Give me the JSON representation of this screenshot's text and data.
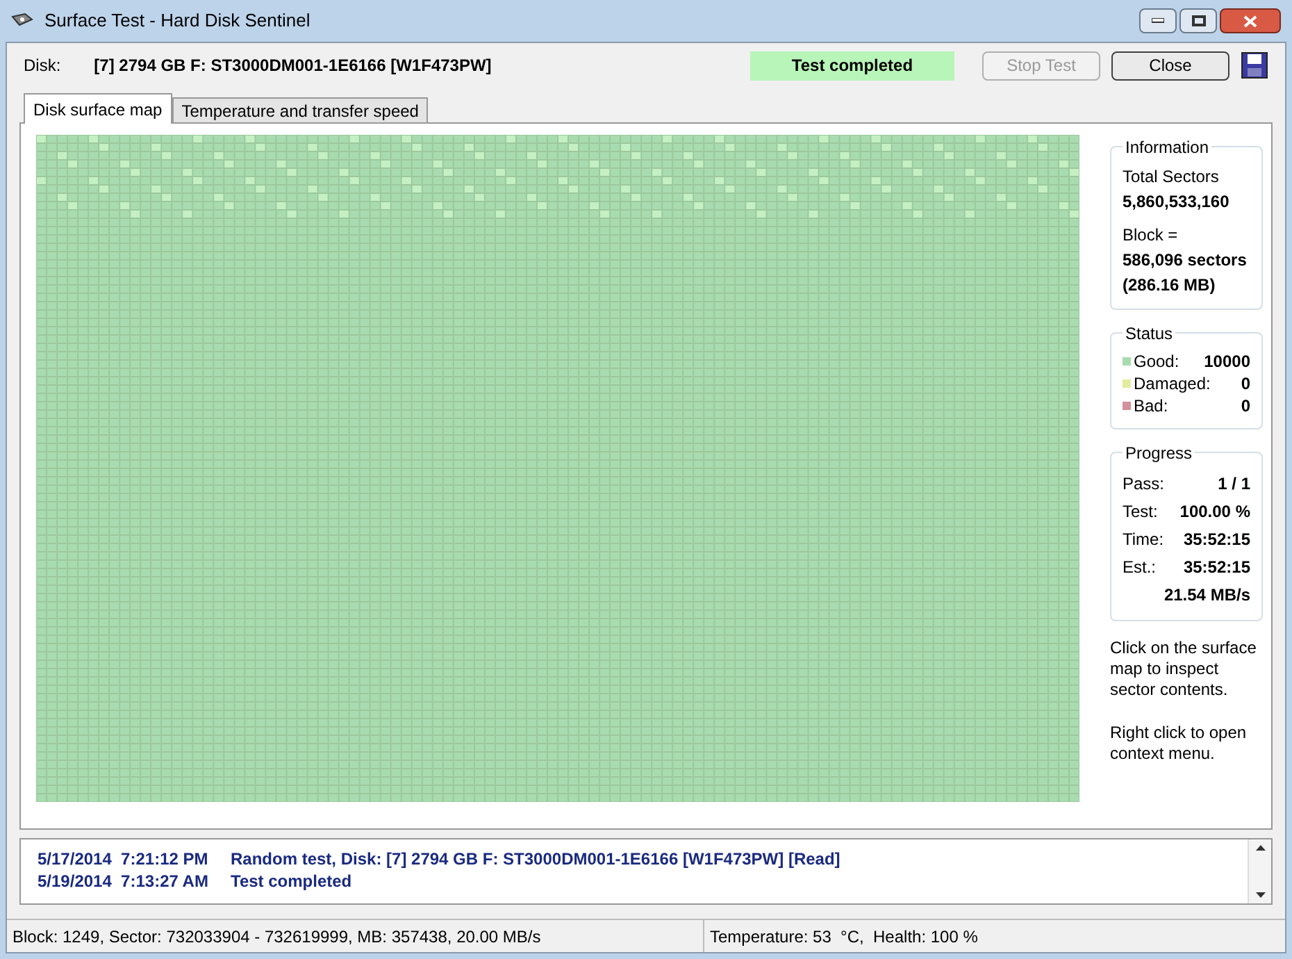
{
  "window": {
    "title": "Surface Test - Hard Disk Sentinel"
  },
  "toolbar": {
    "disk_label": "Disk:",
    "disk": "[7] 2794 GB F: ST3000DM001-1E6166 [W1F473PW]",
    "status": "Test completed",
    "buttons": [
      {
        "label": "Stop Test",
        "disabled": true
      },
      {
        "label": "Close",
        "disabled": false
      }
    ]
  },
  "tabs": [
    {
      "label": "Disk surface map",
      "selected": true
    },
    {
      "label": "Temperature and transfer speed",
      "selected": false
    }
  ],
  "information": {
    "title": "Information",
    "total_label": "Total Sectors",
    "total": "5,860,533,160",
    "block_label": "Block =",
    "block_sectors": "586,096 sectors",
    "block_size": "(286.16 MB)"
  },
  "status": {
    "title": "Status",
    "items": [
      {
        "label": "Good:",
        "value": "10000",
        "color": "#a8dcb0"
      },
      {
        "label": "Damaged:",
        "value": "0",
        "color": "#e4eca0"
      },
      {
        "label": "Bad:",
        "value": "0",
        "color": "#d4909c"
      }
    ]
  },
  "progress": {
    "title": "Progress",
    "rows": [
      {
        "label": "Pass:",
        "value": "1 / 1"
      },
      {
        "label": "Test:",
        "value": "100.00 %"
      },
      {
        "label": "Time:",
        "value": "35:52:15"
      },
      {
        "label": "Est.:",
        "value": "35:52:15"
      },
      {
        "label": "",
        "value": "21.54 MB/s"
      }
    ]
  },
  "hints": [
    "Click on the surface map to inspect sector contents.",
    "Right click to open context menu."
  ],
  "log": [
    {
      "time": "5/17/2014  7:21:12 PM",
      "message": "Random test, Disk: [7] 2794 GB F: ST3000DM001-1E6166 [W1F473PW] [Read]"
    },
    {
      "time": "5/19/2014  7:13:27 AM",
      "message": "Test completed"
    }
  ],
  "status_bar": [
    "Block: 1249, Sector: 732033904 - 732619999, MB: 357438, 20.00 MB/s",
    "Temperature: 53  °C,  Health: 100 %"
  ]
}
